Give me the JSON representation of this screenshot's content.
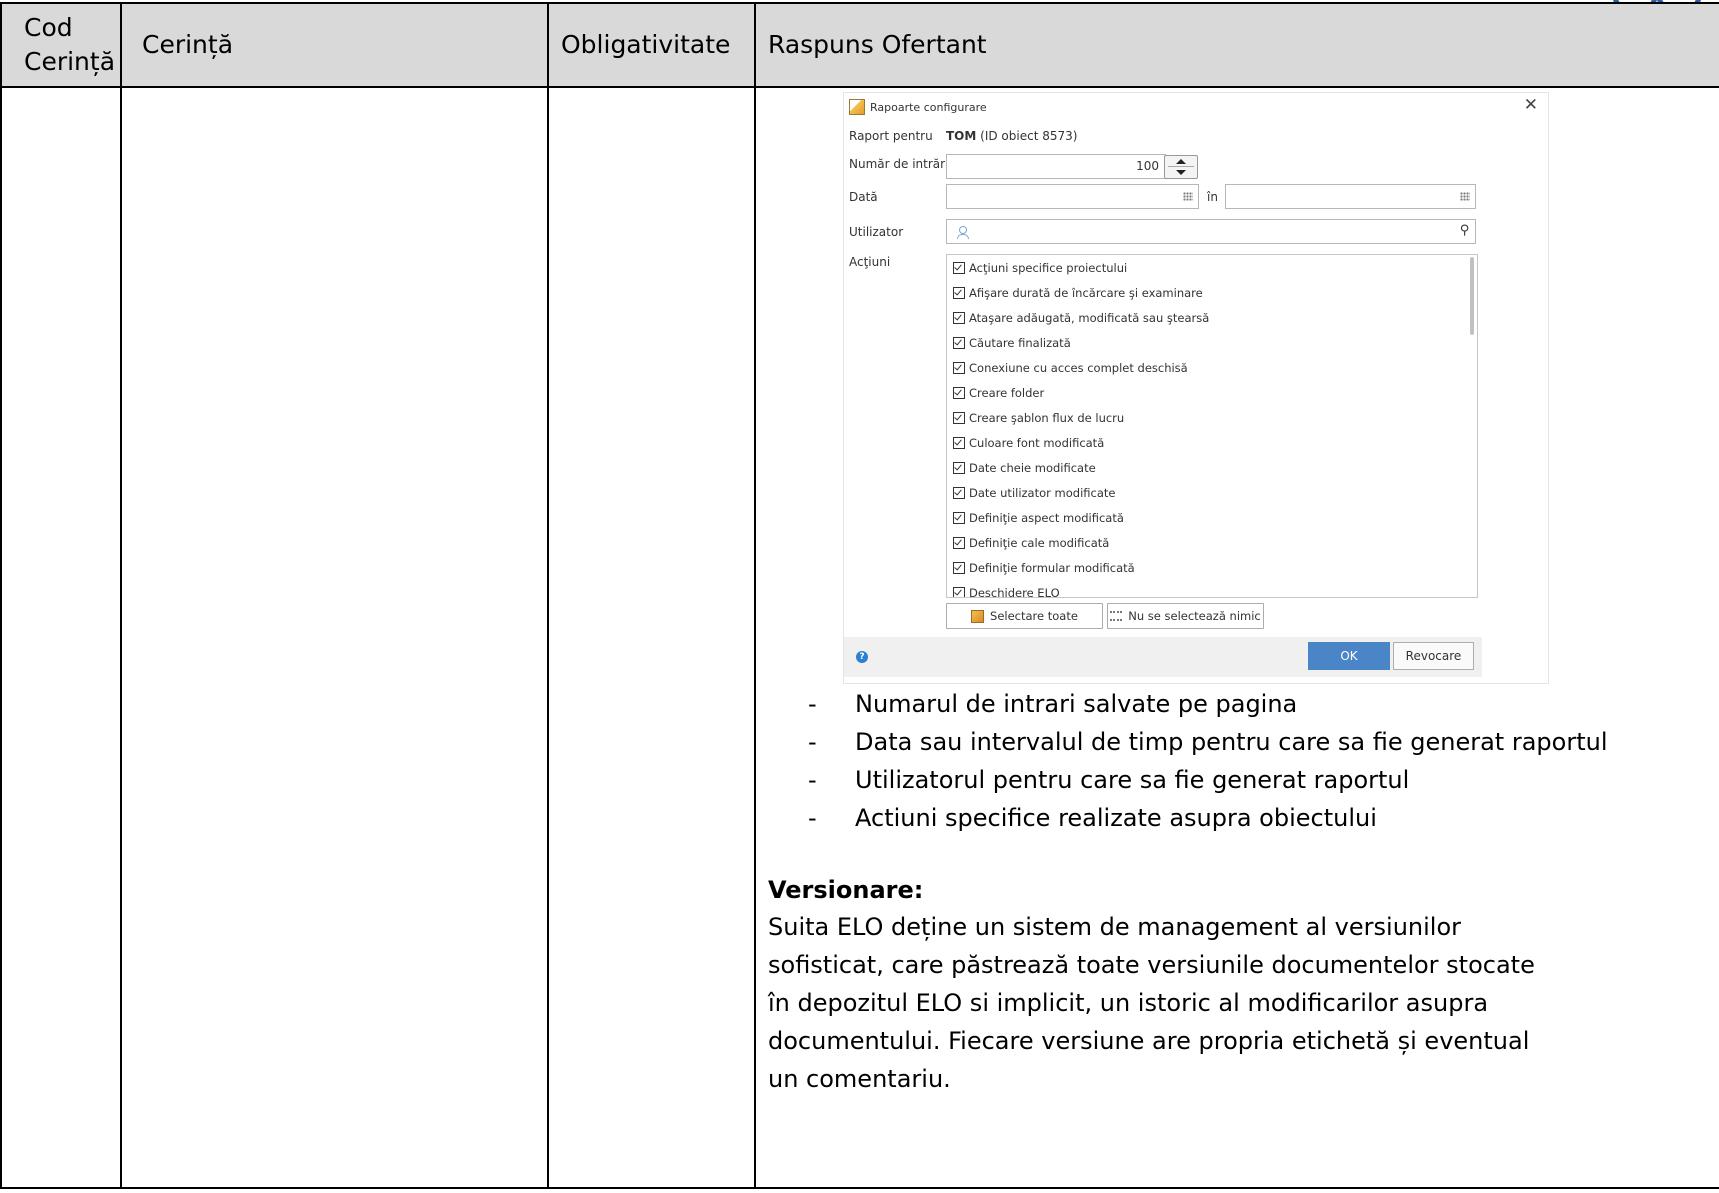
{
  "table": {
    "headers": {
      "cod": "Cod Cerință",
      "cerinta": "Cerință",
      "obligativitate": "Obligativitate",
      "raspuns": "Raspuns Ofertant"
    }
  },
  "dialog": {
    "title": "Rapoarte configurare",
    "raport_pentru_label": "Raport pentru",
    "raport_pentru_value_bold": "TOM",
    "raport_pentru_value_rest": "(ID obiect 8573)",
    "numar_label": "Număr de intrări",
    "numar_value": "100",
    "data_label": "Dată",
    "data_in_label": "în",
    "utilizator_label": "Utilizator",
    "actiuni_label": "Acţiuni",
    "actions": [
      "Acţiuni specifice proiectului",
      "Afişare durată de încărcare şi examinare",
      "Ataşare adăugată, modificată sau ştearsă",
      "Căutare finalizată",
      "Conexiune cu acces complet deschisă",
      "Creare folder",
      "Creare şablon flux de lucru",
      "Culoare font modificată",
      "Date cheie modificate",
      "Date utilizator modificate",
      "Definiţie aspect modificată",
      "Definiţie cale modificată",
      "Definiţie formular modificată",
      "Deschidere ELO"
    ],
    "select_all_label": "Selectare toate",
    "select_none_label": "Nu se selectează nimic",
    "ok_label": "OK",
    "cancel_label": "Revocare"
  },
  "bullets": [
    "Numarul de intrari salvate pe pagina",
    "Data sau intervalul de timp pentru care sa fie generat raportul",
    "Utilizatorul pentru care sa fie generat raportul",
    "Actiuni specifice realizate asupra obiectului"
  ],
  "versionare": {
    "title": "Versionare:",
    "body": "Suita ELO deține un sistem de management al versiunilor sofisticat, care păstrează toate versiunile documentelor stocate în depozitul ELO si implicit, un istoric al modificarilor asupra documentului. Fiecare versiune are propria etichetă și eventual un comentariu."
  }
}
